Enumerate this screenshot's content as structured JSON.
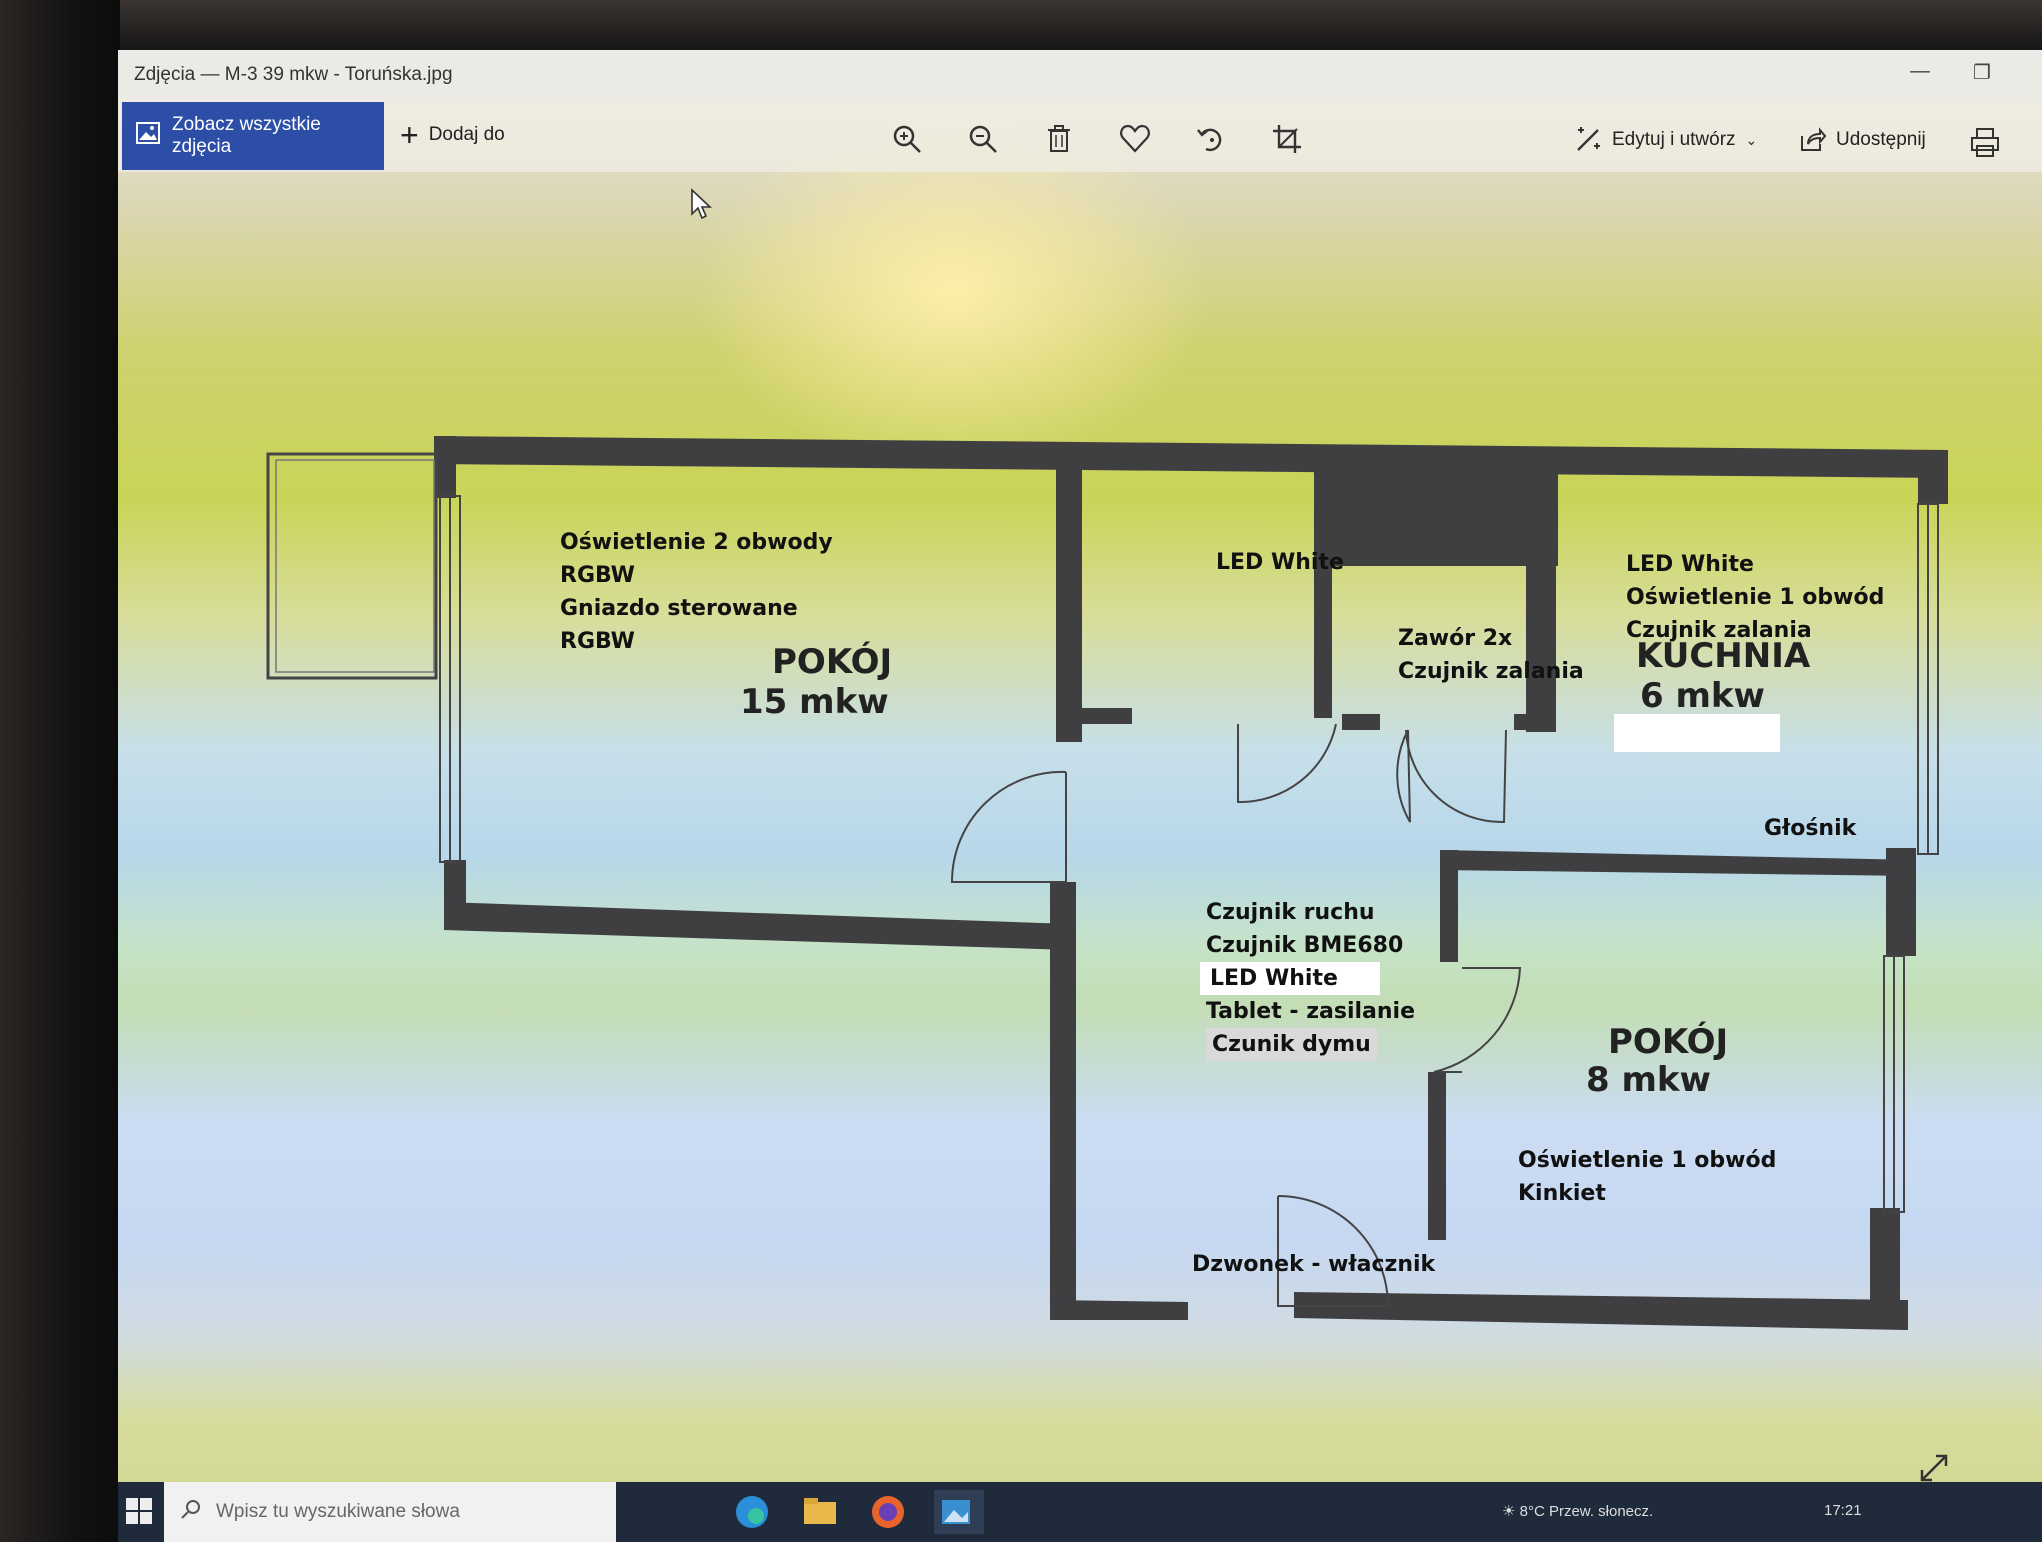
{
  "window": {
    "title": "Zdjęcia — M-3 39 mkw - Toruńska.jpg"
  },
  "toolbar": {
    "see_all_label": "Zobacz wszystkie zdjęcia",
    "add_to_label": "Dodaj do",
    "edit_label": "Edytuj i utwórz",
    "share_label": "Udostępnij",
    "tools": [
      "zoom-in-icon",
      "zoom-out-icon",
      "delete-icon",
      "heart-icon",
      "rotate-icon",
      "crop-icon"
    ]
  },
  "floorplan": {
    "living_room": {
      "name": "POKÓJ",
      "area": "15 mkw",
      "notes": [
        "Oświetlenie 2 obwody",
        "RGBW",
        "Gniazdo sterowane",
        "RGBW"
      ]
    },
    "bathroom": {
      "notes": [
        "LED White"
      ]
    },
    "wc": {
      "notes": [
        "Zawór 2x",
        "Czujnik zalania"
      ]
    },
    "kitchen": {
      "name": "KUCHNIA",
      "area": "6 mkw",
      "notes": [
        "LED White",
        "Oświetlenie 1 obwód",
        "Czujnik zalania"
      ],
      "speaker": "Głośnik"
    },
    "hall": {
      "notes": [
        "Czujnik ruchu",
        "Czujnik BME680",
        "LED White",
        "Tablet - zasilanie",
        "Czunik dymu"
      ],
      "doorbell": "Dzwonek - włacznik"
    },
    "bedroom": {
      "name": "POKÓJ",
      "area": "8 mkw",
      "notes": [
        "Oświetlenie 1 obwód",
        "Kinkiet"
      ]
    }
  },
  "taskbar": {
    "search_placeholder": "Wpisz tu wyszukiwane słowa",
    "weather": "8°C  Przew. słonecz.",
    "clock": "17:21"
  },
  "colors": {
    "accent": "#2d4ea6",
    "wall": "#3f3f42"
  }
}
